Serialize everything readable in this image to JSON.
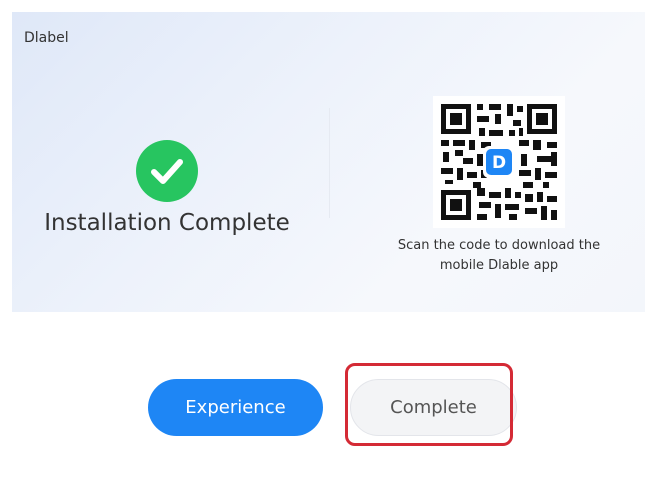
{
  "window": {
    "title": "Dlabel"
  },
  "status": {
    "icon": "check-circle-icon",
    "title": "Installation Complete",
    "color": "#27c560"
  },
  "download": {
    "qr_icon": "qr-code-icon",
    "logo_icon": "dlable-logo-icon",
    "text": "Scan the code to download the mobile Dlable app"
  },
  "actions": {
    "experience_label": "Experience",
    "complete_label": "Complete",
    "experience_color": "#1e86f5",
    "highlight_color": "#d42a35"
  }
}
